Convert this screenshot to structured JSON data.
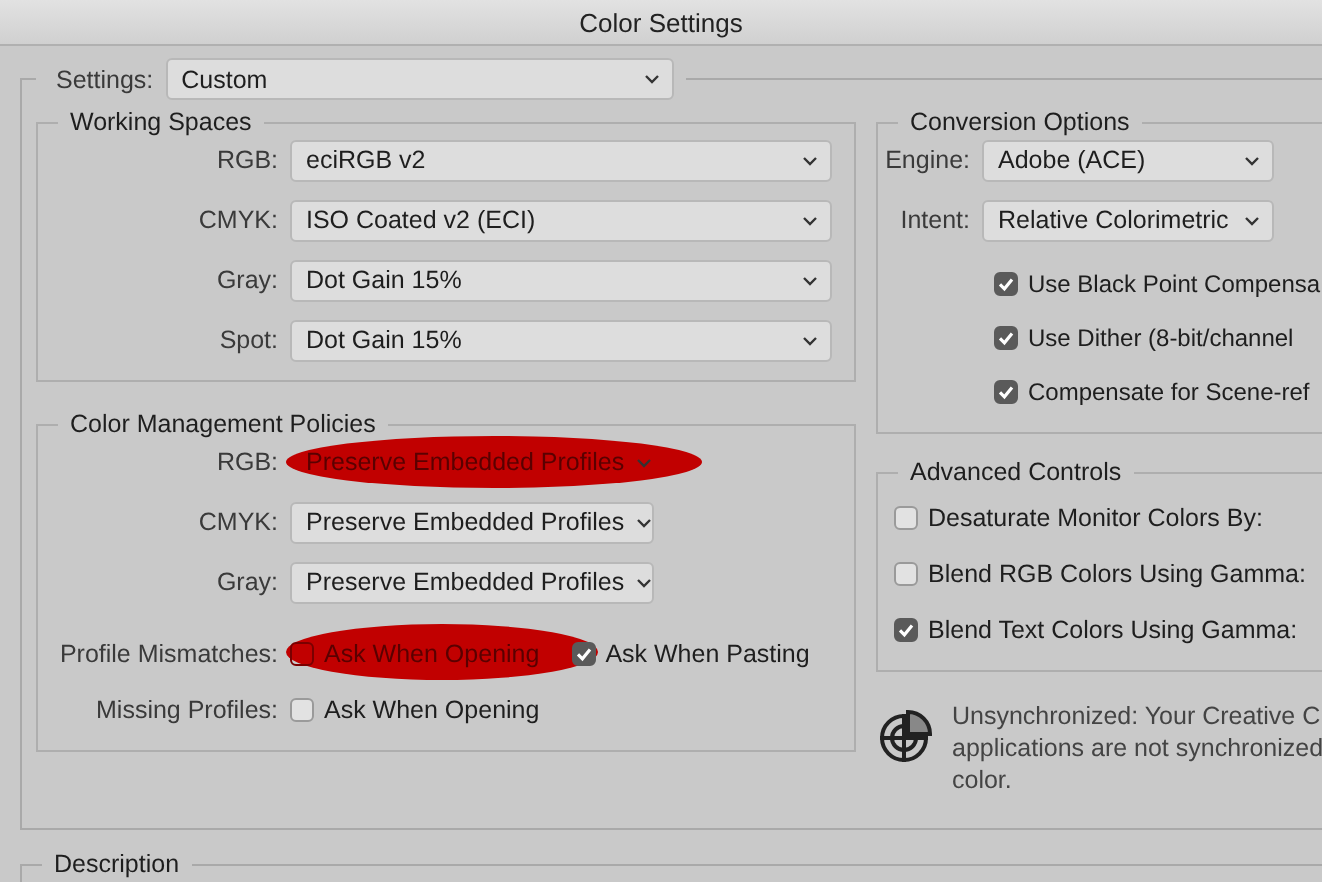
{
  "window": {
    "title": "Color Settings"
  },
  "settings": {
    "label": "Settings:",
    "value": "Custom"
  },
  "working_spaces": {
    "title": "Working Spaces",
    "rows": [
      {
        "label": "RGB:",
        "value": "eciRGB v2"
      },
      {
        "label": "CMYK:",
        "value": "ISO Coated v2 (ECI)"
      },
      {
        "label": "Gray:",
        "value": "Dot Gain 15%"
      },
      {
        "label": "Spot:",
        "value": "Dot Gain 15%"
      }
    ]
  },
  "color_management_policies": {
    "title": "Color Management Policies",
    "rows": [
      {
        "label": "RGB:",
        "value": "Preserve Embedded Profiles",
        "highlighted": true
      },
      {
        "label": "CMYK:",
        "value": "Preserve Embedded Profiles",
        "highlighted": false
      },
      {
        "label": "Gray:",
        "value": "Preserve Embedded Profiles",
        "highlighted": false
      }
    ],
    "options": [
      {
        "label": "Profile Mismatches:",
        "checkboxes": [
          {
            "text": "Ask When Opening",
            "checked": false,
            "highlighted": true
          },
          {
            "text": "Ask When Pasting",
            "checked": true,
            "highlighted": false
          }
        ]
      },
      {
        "label": "Missing Profiles:",
        "checkboxes": [
          {
            "text": "Ask When Opening",
            "checked": false,
            "highlighted": false
          }
        ]
      }
    ]
  },
  "conversion_options": {
    "title": "Conversion Options",
    "rows": [
      {
        "label": "Engine:",
        "value": "Adobe (ACE)"
      },
      {
        "label": "Intent:",
        "value": "Relative Colorimetric"
      }
    ],
    "checkboxes": [
      {
        "text": "Use Black Point Compensa",
        "checked": true
      },
      {
        "text": "Use Dither (8-bit/channel",
        "checked": true
      },
      {
        "text": "Compensate for Scene-ref",
        "checked": true
      }
    ]
  },
  "advanced_controls": {
    "title": "Advanced Controls",
    "checkboxes": [
      {
        "text": "Desaturate Monitor Colors By:",
        "checked": false
      },
      {
        "text": "Blend RGB Colors Using Gamma:",
        "checked": false
      },
      {
        "text": "Blend Text Colors Using Gamma:",
        "checked": true
      }
    ]
  },
  "sync_status": {
    "lines": [
      "Unsynchronized: Your Creative C",
      "applications are not synchronized",
      "color."
    ]
  },
  "description": {
    "title": "Description"
  }
}
